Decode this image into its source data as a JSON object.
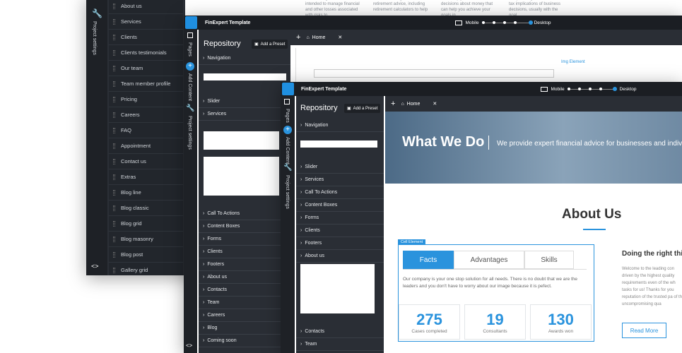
{
  "w1": {
    "items": [
      "About us",
      "Services",
      "Clients",
      "Clients testimonials",
      "Our team",
      "Team member profile",
      "Pricing",
      "Careers",
      "FAQ",
      "Appointment",
      "Contact us",
      "Extras",
      "Blog line",
      "Blog classic",
      "Blog grid",
      "Blog masonry",
      "Blog post",
      "Gallery grid"
    ],
    "rail_label": "Project settings",
    "text_cols": [
      "Risk management is intended to manage financial and other losses associated with risks to",
      "Use our strategies and retirement advice, including retirement calculators to help",
      "We'll help you make sensible decisions about money that can help you achieve your goals in",
      "Tax planning considers the tax implications of business decisions, usually with the goal"
    ]
  },
  "w2": {
    "title": "FinExpert Template",
    "mobile": "Mobile",
    "desktop": "Desktop",
    "tab_home": "Home",
    "repo_title": "Repository",
    "add_preset": "Add a Preset",
    "rail_pages": "Pages",
    "rail_add": "Add Content",
    "rail_settings": "Project settings",
    "sections_top": [
      "Navigation"
    ],
    "sections_mid": [
      "Slider",
      "Services"
    ],
    "sections_bottom": [
      "Call To Actions",
      "Content Boxes",
      "Forms",
      "Clients",
      "Footers",
      "About us",
      "Contacts",
      "Team",
      "Careers",
      "Blog",
      "Coming soon"
    ],
    "img_element": "Img Element"
  },
  "w3": {
    "title": "FinExpert Template",
    "mobile": "Mobile",
    "desktop": "Desktop",
    "tab_home": "Home",
    "repo_title": "Repository",
    "add_preset": "Add a Preset",
    "rail_pages": "Pages",
    "rail_add": "Add Content",
    "rail_settings": "Project settings",
    "sections_a": [
      "Navigation"
    ],
    "sections_b": [
      "Slider",
      "Services",
      "Call To Actions",
      "Content Boxes",
      "Forms",
      "Clients",
      "Footers",
      "About us"
    ],
    "sections_c": [
      "Contacts",
      "Team"
    ],
    "hero_title": "What We Do",
    "hero_sub": "We provide expert financial advice for businesses and indiv",
    "about_title": "About Us",
    "cell_element": "Cell Element",
    "tabs": [
      "Facts",
      "Advantages",
      "Skills"
    ],
    "body": "Our company is your one stop solution for all needs. There is no doubt that we are the leaders and you don't have to worry about our image because it is pefect.",
    "stats": [
      {
        "num": "275",
        "label": "Cases completed"
      },
      {
        "num": "19",
        "label": "Consultants"
      },
      {
        "num": "130",
        "label": "Awards won"
      }
    ],
    "side_title": "Doing the right thi",
    "side_text": "Welcome to the leading con driven by the highest quality requirements even of the wh tasks for us! Thanks for you reputation of the trusted pa of the uncompromising qua",
    "read_more": "Read More"
  },
  "colors": {
    "accent": "#2a93dd",
    "dark": "#22262c"
  }
}
